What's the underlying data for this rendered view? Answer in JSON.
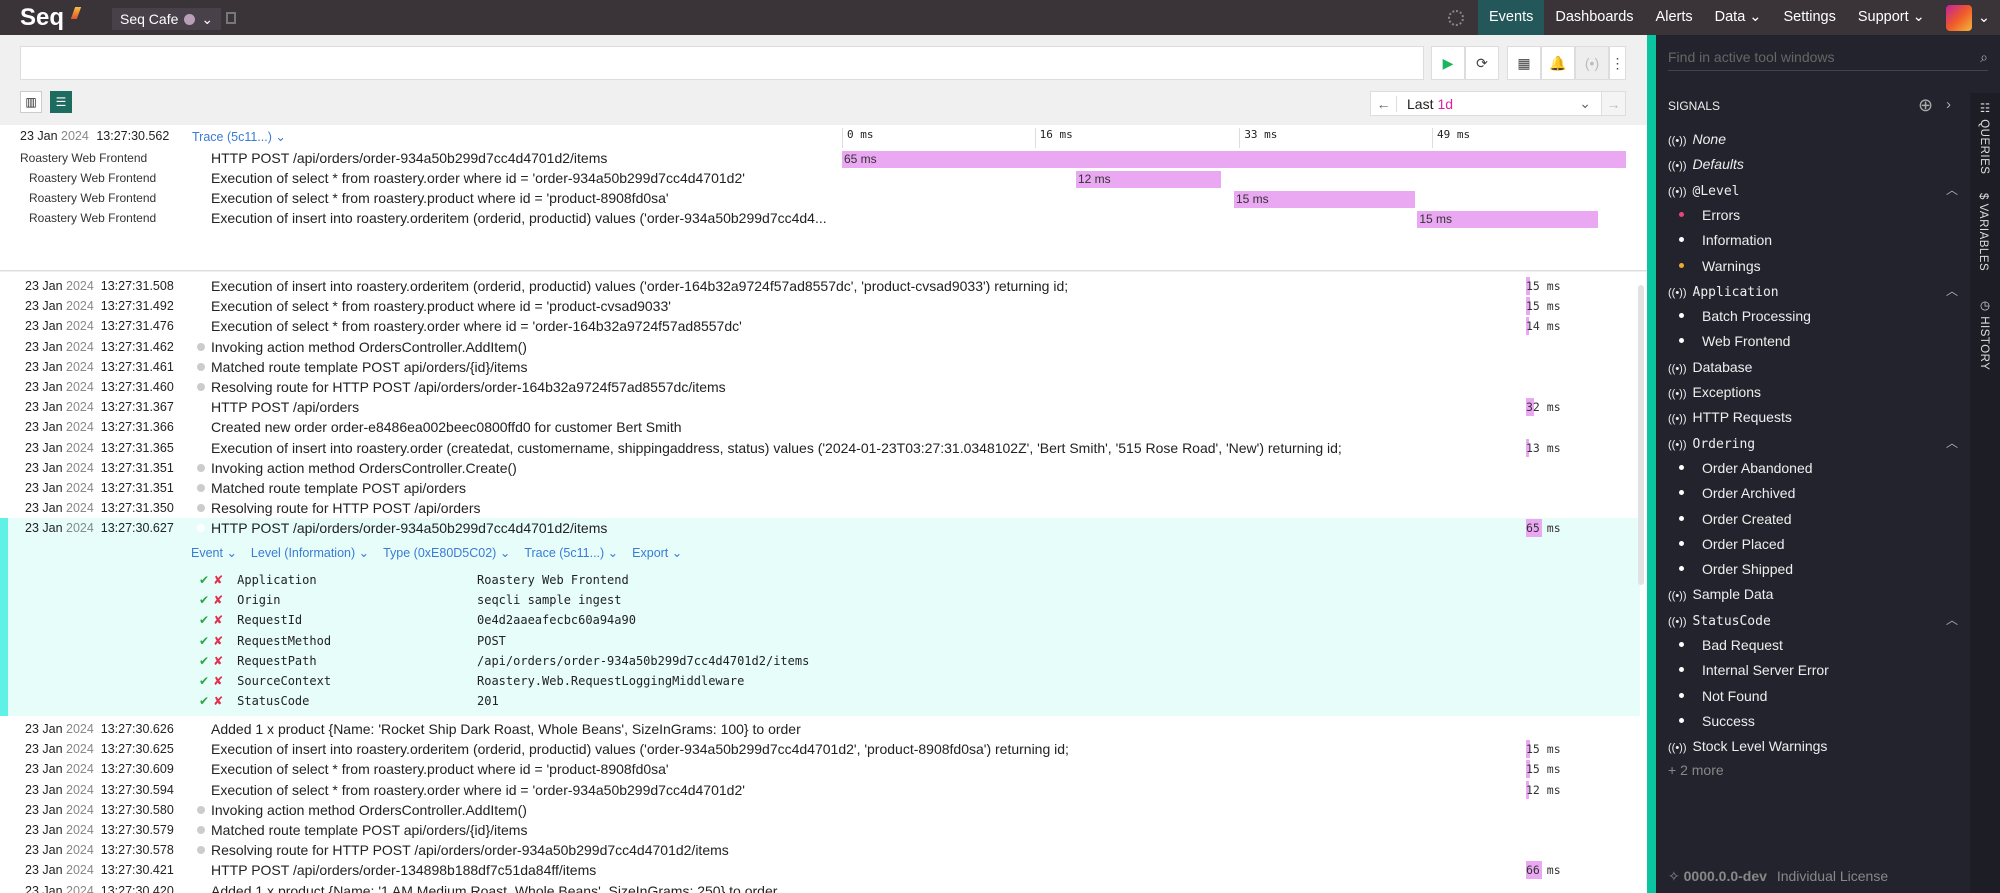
{
  "topbar": {
    "logo": "Seq",
    "workspace": "Seq Cafe",
    "nav": [
      "Events",
      "Dashboards",
      "Alerts",
      "Data",
      "Settings",
      "Support"
    ],
    "active": "Events"
  },
  "toolbar": {
    "search_placeholder": "",
    "range_prefix": "Last",
    "range_value": "1d"
  },
  "trace": {
    "timestamp_date": "23 Jan",
    "timestamp_year": "2024",
    "timestamp_time": "13:27:30.562",
    "trace_label": "Trace (5c11...)",
    "ticks": [
      "0 ms",
      "16 ms",
      "33 ms",
      "49 ms"
    ],
    "total_ms": 65,
    "spans": [
      {
        "service": "Roastery Web Frontend",
        "message": "HTTP POST /api/orders/order-934a50b299d7cc4d4701d2/items",
        "start_ms": 0,
        "duration_ms": 65,
        "label": "65 ms"
      },
      {
        "service": "Roastery Web Frontend",
        "message": "Execution of select * from roastery.order where id = 'order-934a50b299d7cc4d4701d2'",
        "start_ms": 19.4,
        "duration_ms": 12,
        "label": "12 ms"
      },
      {
        "service": "Roastery Web Frontend",
        "message": "Execution of select * from roastery.product where id = 'product-8908fd0sa'",
        "start_ms": 32.5,
        "duration_ms": 15,
        "label": "15 ms"
      },
      {
        "service": "Roastery Web Frontend",
        "message": "Execution of insert into roastery.orderitem (orderid, productid) values ('order-934a50b299d7cc4d4...",
        "start_ms": 47.7,
        "duration_ms": 15,
        "label": "15 ms"
      }
    ]
  },
  "events_before": [
    {
      "date": "23 Jan",
      "year": "2024",
      "time": "13:27:31.508",
      "message": "Execution of insert into roastery.orderitem (orderid, productid) values ('order-164b32a9724f57ad8557dc', 'product-cvsad9033') returning id;",
      "dot": false,
      "duration": 15
    },
    {
      "date": "23 Jan",
      "year": "2024",
      "time": "13:27:31.492",
      "message": "Execution of select * from roastery.product where id = 'product-cvsad9033'",
      "dot": false,
      "duration": 15
    },
    {
      "date": "23 Jan",
      "year": "2024",
      "time": "13:27:31.476",
      "message": "Execution of select * from roastery.order where id = 'order-164b32a9724f57ad8557dc'",
      "dot": false,
      "duration": 14
    },
    {
      "date": "23 Jan",
      "year": "2024",
      "time": "13:27:31.462",
      "message": "Invoking action method OrdersController.AddItem()",
      "dot": true,
      "duration": null
    },
    {
      "date": "23 Jan",
      "year": "2024",
      "time": "13:27:31.461",
      "message": "Matched route template POST api/orders/{id}/items",
      "dot": true,
      "duration": null
    },
    {
      "date": "23 Jan",
      "year": "2024",
      "time": "13:27:31.460",
      "message": "Resolving route for HTTP POST /api/orders/order-164b32a9724f57ad8557dc/items",
      "dot": true,
      "duration": null
    },
    {
      "date": "23 Jan",
      "year": "2024",
      "time": "13:27:31.367",
      "message": "HTTP POST /api/orders",
      "dot": false,
      "duration": 32
    },
    {
      "date": "23 Jan",
      "year": "2024",
      "time": "13:27:31.366",
      "message": "Created new order order-e8486ea002beec0800ffd0 for customer Bert Smith",
      "dot": false,
      "duration": null
    },
    {
      "date": "23 Jan",
      "year": "2024",
      "time": "13:27:31.365",
      "message": "Execution of insert into roastery.order (createdat, customername, shippingaddress, status) values ('2024-01-23T03:27:31.0348102Z', 'Bert Smith', '515 Rose Road', 'New') returning id;",
      "dot": false,
      "duration": 13
    },
    {
      "date": "23 Jan",
      "year": "2024",
      "time": "13:27:31.351",
      "message": "Invoking action method OrdersController.Create()",
      "dot": true,
      "duration": null
    },
    {
      "date": "23 Jan",
      "year": "2024",
      "time": "13:27:31.351",
      "message": "Matched route template POST api/orders",
      "dot": true,
      "duration": null
    },
    {
      "date": "23 Jan",
      "year": "2024",
      "time": "13:27:31.350",
      "message": "Resolving route for HTTP POST /api/orders",
      "dot": true,
      "duration": null
    }
  ],
  "selected": {
    "date": "23 Jan",
    "year": "2024",
    "time": "13:27:30.627",
    "message": "HTTP POST /api/orders/order-934a50b299d7cc4d4701d2/items",
    "duration": 65,
    "links": [
      "Event",
      "Level (Information)",
      "Type (0xE80D5C02)",
      "Trace (5c11...)",
      "Export"
    ],
    "properties": [
      {
        "name": "Application",
        "value": "Roastery Web Frontend"
      },
      {
        "name": "Origin",
        "value": "seqcli sample ingest"
      },
      {
        "name": "RequestId",
        "value": "0e4d2aaeafecbc60a94a90"
      },
      {
        "name": "RequestMethod",
        "value": "POST"
      },
      {
        "name": "RequestPath",
        "value": "/api/orders/order-934a50b299d7cc4d4701d2/items"
      },
      {
        "name": "SourceContext",
        "value": "Roastery.Web.RequestLoggingMiddleware"
      },
      {
        "name": "StatusCode",
        "value": "201"
      }
    ]
  },
  "events_after": [
    {
      "date": "23 Jan",
      "year": "2024",
      "time": "13:27:30.626",
      "message": "Added 1 x product {Name: 'Rocket Ship Dark Roast, Whole Beans', SizeInGrams: 100} to order",
      "dot": false,
      "duration": null
    },
    {
      "date": "23 Jan",
      "year": "2024",
      "time": "13:27:30.625",
      "message": "Execution of insert into roastery.orderitem (orderid, productid) values ('order-934a50b299d7cc4d4701d2', 'product-8908fd0sa') returning id;",
      "dot": false,
      "duration": 15
    },
    {
      "date": "23 Jan",
      "year": "2024",
      "time": "13:27:30.609",
      "message": "Execution of select * from roastery.product where id = 'product-8908fd0sa'",
      "dot": false,
      "duration": 15
    },
    {
      "date": "23 Jan",
      "year": "2024",
      "time": "13:27:30.594",
      "message": "Execution of select * from roastery.order where id = 'order-934a50b299d7cc4d4701d2'",
      "dot": false,
      "duration": 12
    },
    {
      "date": "23 Jan",
      "year": "2024",
      "time": "13:27:30.580",
      "message": "Invoking action method OrdersController.AddItem()",
      "dot": true,
      "duration": null
    },
    {
      "date": "23 Jan",
      "year": "2024",
      "time": "13:27:30.579",
      "message": "Matched route template POST api/orders/{id}/items",
      "dot": true,
      "duration": null
    },
    {
      "date": "23 Jan",
      "year": "2024",
      "time": "13:27:30.578",
      "message": "Resolving route for HTTP POST /api/orders/order-934a50b299d7cc4d4701d2/items",
      "dot": true,
      "duration": null
    },
    {
      "date": "23 Jan",
      "year": "2024",
      "time": "13:27:30.421",
      "message": "HTTP POST /api/orders/order-134898b188df7c51da84ff/items",
      "dot": false,
      "duration": 66
    },
    {
      "date": "23 Jan",
      "year": "2024",
      "time": "13:27:30.420",
      "message": "Added 1 x product {Name: '1 AM Medium Roast, Whole Beans', SizeInGrams: 250} to order",
      "dot": false,
      "duration": null
    }
  ],
  "sidebar": {
    "find_placeholder": "Find in active tool windows",
    "title": "SIGNALS",
    "vtabs": [
      "QUERIES",
      "VARIABLES",
      "HISTORY"
    ],
    "signals": [
      {
        "label": "None",
        "kind": "signal",
        "style": "italic"
      },
      {
        "label": "Defaults",
        "kind": "signal",
        "style": "italic"
      },
      {
        "label": "@Level",
        "kind": "group",
        "style": "mono"
      },
      {
        "label": "Errors",
        "kind": "item",
        "color": "#e8457a"
      },
      {
        "label": "Information",
        "kind": "item",
        "color": "#ffffff"
      },
      {
        "label": "Warnings",
        "kind": "item",
        "color": "#f0a830"
      },
      {
        "label": "Application",
        "kind": "group",
        "style": "mono"
      },
      {
        "label": "Batch Processing",
        "kind": "item"
      },
      {
        "label": "Web Frontend",
        "kind": "item"
      },
      {
        "label": "Database",
        "kind": "signal"
      },
      {
        "label": "Exceptions",
        "kind": "signal"
      },
      {
        "label": "HTTP Requests",
        "kind": "signal"
      },
      {
        "label": "Ordering",
        "kind": "group",
        "style": "mono"
      },
      {
        "label": "Order Abandoned",
        "kind": "item"
      },
      {
        "label": "Order Archived",
        "kind": "item"
      },
      {
        "label": "Order Created",
        "kind": "item"
      },
      {
        "label": "Order Placed",
        "kind": "item"
      },
      {
        "label": "Order Shipped",
        "kind": "item"
      },
      {
        "label": "Sample Data",
        "kind": "signal"
      },
      {
        "label": "StatusCode",
        "kind": "group",
        "style": "mono"
      },
      {
        "label": "Bad Request",
        "kind": "item"
      },
      {
        "label": "Internal Server Error",
        "kind": "item"
      },
      {
        "label": "Not Found",
        "kind": "item"
      },
      {
        "label": "Success",
        "kind": "item"
      },
      {
        "label": "Stock Level Warnings",
        "kind": "signal"
      }
    ],
    "more": "+ 2 more",
    "version": "0000.0.0-dev",
    "license": "Individual License"
  }
}
